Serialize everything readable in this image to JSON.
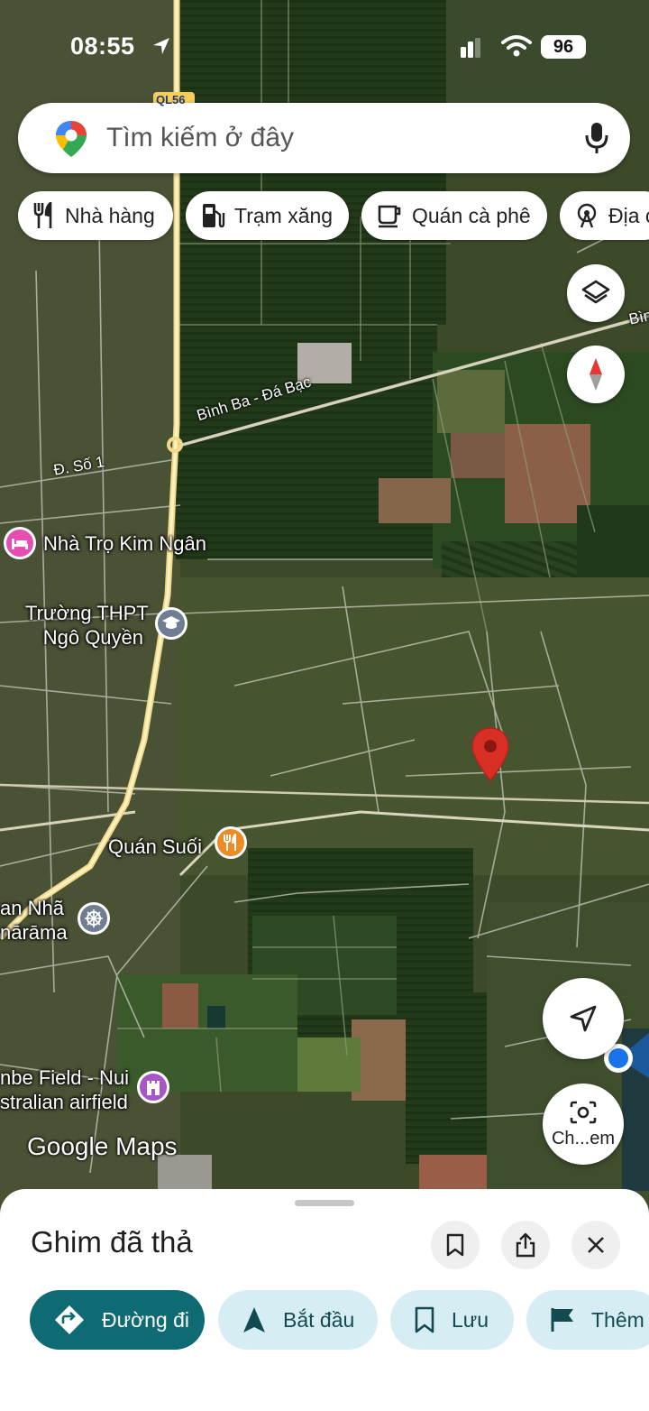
{
  "status_bar": {
    "time": "08:55",
    "battery": "96"
  },
  "search": {
    "placeholder": "Tìm kiếm ở đây"
  },
  "chips": [
    {
      "label": "Nhà hàng",
      "icon": "restaurant-icon"
    },
    {
      "label": "Trạm xăng",
      "icon": "gas-station-icon"
    },
    {
      "label": "Quán cà phê",
      "icon": "coffee-icon"
    },
    {
      "label": "Địa c",
      "icon": "attraction-icon"
    }
  ],
  "map": {
    "roads": {
      "highway": "QL56",
      "road_1": "Bình Ba - Đá Bạc",
      "road_2": "Đ. Số 1",
      "road_3_partial": "Bìn"
    },
    "places": [
      {
        "label": "Nhà Trọ Kim Ngân",
        "icon": "hotel-icon",
        "color": "#e94cb0"
      },
      {
        "label_line1": "Trường THPT",
        "label_line2": "Ngô Quyền",
        "icon": "school-icon",
        "color": "#6f7f91"
      },
      {
        "label": "Quán Suối",
        "icon": "restaurant-icon",
        "color": "#f08a24"
      },
      {
        "label_line1": "an Nhã",
        "label_line2": "nārāma",
        "icon": "temple-icon",
        "color": "#6f7f91"
      },
      {
        "label_line1": "nbe Field - Nui",
        "label_line2": "stralian airfield",
        "icon": "castle-icon",
        "color": "#a855c7"
      }
    ],
    "dropped_pin_color": "#d93025",
    "attribution": "Google Maps",
    "lens_label": "Ch...em"
  },
  "sheet": {
    "title": "Ghim đã thả",
    "actions": [
      {
        "label": "Đường đi",
        "icon": "directions-icon"
      },
      {
        "label": "Bắt đầu",
        "icon": "navigation-icon"
      },
      {
        "label": "Lưu",
        "icon": "bookmark-icon"
      },
      {
        "label": "Thêm",
        "icon": "flag-icon"
      }
    ]
  },
  "colors": {
    "primary": "#0e6b74",
    "secondary": "#d6eef3",
    "location_dot": "#1a73e8"
  }
}
